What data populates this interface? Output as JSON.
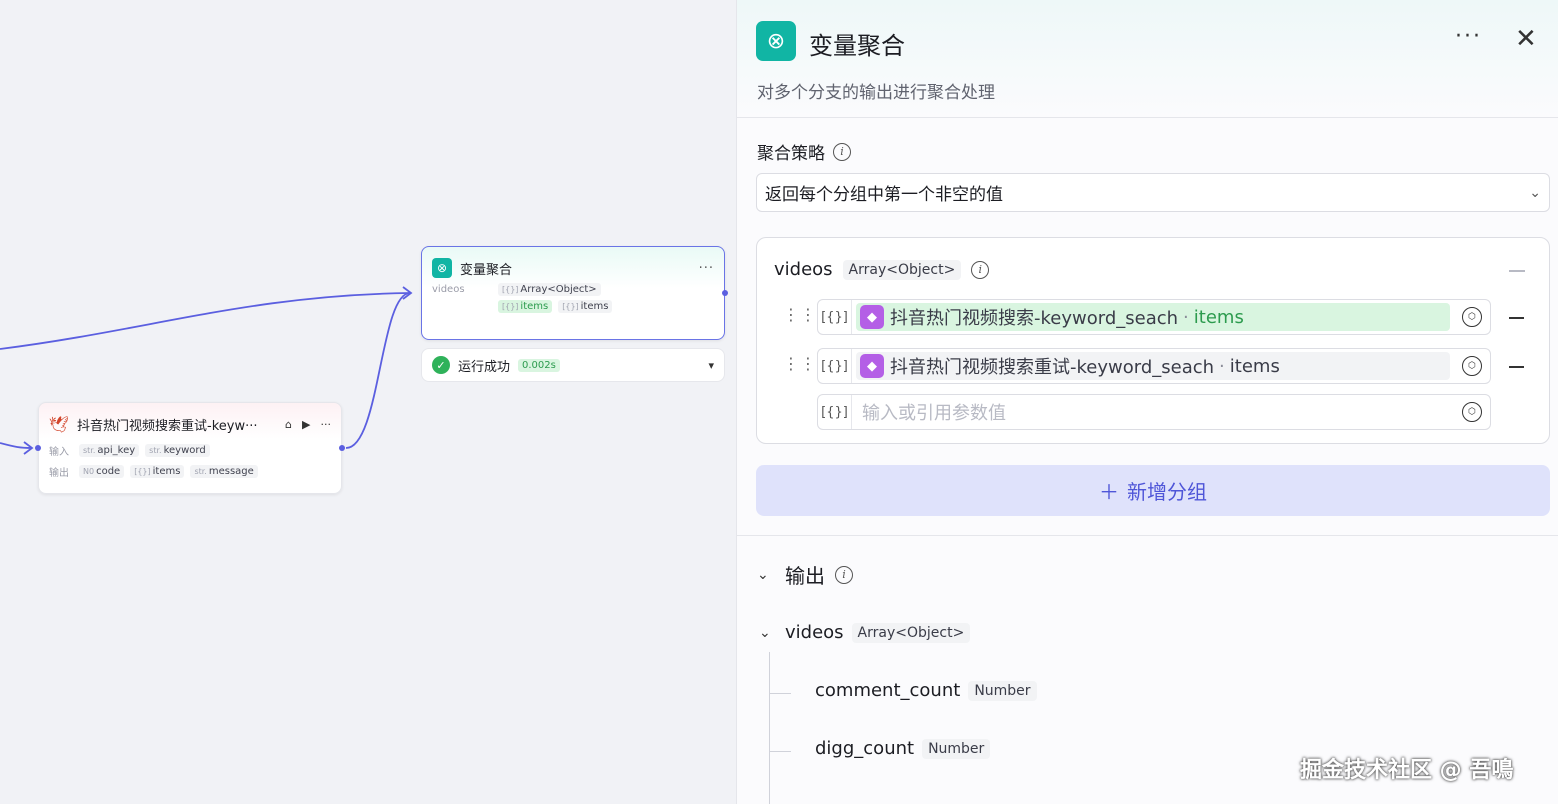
{
  "canvas": {
    "agg_node": {
      "title": "变量聚合",
      "more": "···",
      "row_label": "videos",
      "type_kind": "[{}]",
      "type_label": "Array<Object>",
      "ref1_kind": "[{}]",
      "ref1_label": "items",
      "ref2_kind": "[{}]",
      "ref2_label": "items"
    },
    "status": {
      "text": "运行成功",
      "time": "0.002s"
    },
    "tool_node": {
      "title": "抖音热门视频搜索重试-keyw···",
      "input_label": "输入",
      "inputs": [
        {
          "kind": "str.",
          "name": "api_key"
        },
        {
          "kind": "str.",
          "name": "keyword"
        }
      ],
      "output_label": "输出",
      "outputs": [
        {
          "kind": "N0",
          "name": "code"
        },
        {
          "kind": "[{}]",
          "name": "items"
        },
        {
          "kind": "str.",
          "name": "message"
        }
      ],
      "more": "···"
    }
  },
  "panel": {
    "title": "变量聚合",
    "description": "对多个分支的输出进行聚合处理",
    "more": "···",
    "close": "✕",
    "strategy_label": "聚合策略",
    "strategy_value": "返回每个分组中第一个非空的值",
    "group": {
      "name": "videos",
      "type": "Array<Object>",
      "refs": [
        {
          "kind": "[{}]",
          "node": "抖音热门视频搜索-keyword_seach",
          "field": "items",
          "highlight": true
        },
        {
          "kind": "[{}]",
          "node": "抖音热门视频搜索重试-keyword_seach",
          "field": "items",
          "highlight": false
        }
      ],
      "empty_kind": "[{}]",
      "empty_placeholder": "输入或引用参数值"
    },
    "add_group_label": "新增分组",
    "output_label": "输出",
    "outputs": {
      "name": "videos",
      "type": "Array<Object>",
      "children": [
        {
          "name": "comment_count",
          "type": "Number"
        },
        {
          "name": "digg_count",
          "type": "Number"
        }
      ]
    }
  },
  "watermark": "掘金技术社区 @ 吾鳴",
  "colors": {
    "accent": "#5b5fe0",
    "teal": "#11b5a4",
    "success": "#2fb25a",
    "plugin": "#b45fe6"
  }
}
